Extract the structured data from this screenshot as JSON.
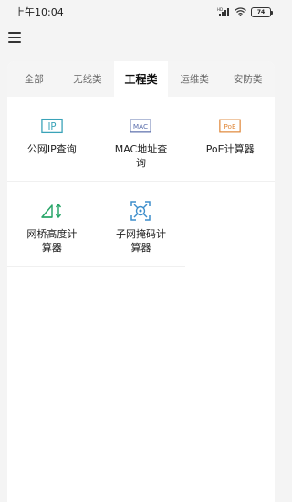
{
  "status": {
    "time": "上午10:04",
    "battery": "74"
  },
  "tabs": [
    {
      "label": "全部"
    },
    {
      "label": "无线类"
    },
    {
      "label": "工程类"
    },
    {
      "label": "运维类"
    },
    {
      "label": "安防类"
    }
  ],
  "active_tab": 2,
  "tools": [
    {
      "label": "公网IP查询",
      "icon": "ip-icon",
      "icon_text": "IP",
      "color": "#3aa3b8"
    },
    {
      "label": "MAC地址查询",
      "icon": "mac-icon",
      "icon_text": "MAC",
      "color": "#5a6dab"
    },
    {
      "label": "PoE计算器",
      "icon": "poe-icon",
      "icon_text": "PoE",
      "color": "#e0883a"
    },
    {
      "label": "网桥高度计算器",
      "icon": "bridge-height-icon",
      "color": "#2aa66a"
    },
    {
      "label": "子网掩码计算器",
      "icon": "subnet-mask-icon",
      "color": "#3e8ecb"
    }
  ]
}
